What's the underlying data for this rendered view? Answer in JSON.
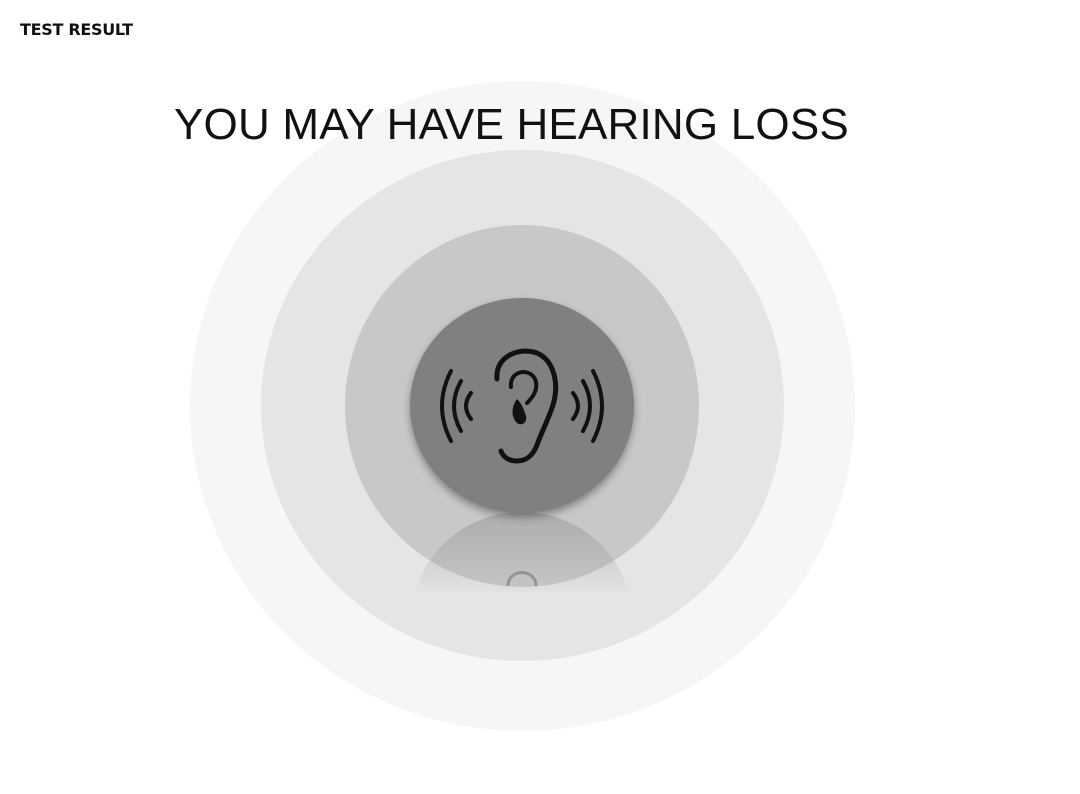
{
  "page": {
    "label": "TEST RESULT"
  },
  "result": {
    "title": "YOU MAY HAVE HEARING LOSS",
    "icon": "ear-with-sound-waves-icon"
  },
  "colors": {
    "outer_ring": "#f6f6f6",
    "middle_ring": "#e5e5e5",
    "inner_ring": "#c8c8c8",
    "icon_disc": "#808080",
    "icon_stroke": "#111111",
    "text": "#111111"
  }
}
